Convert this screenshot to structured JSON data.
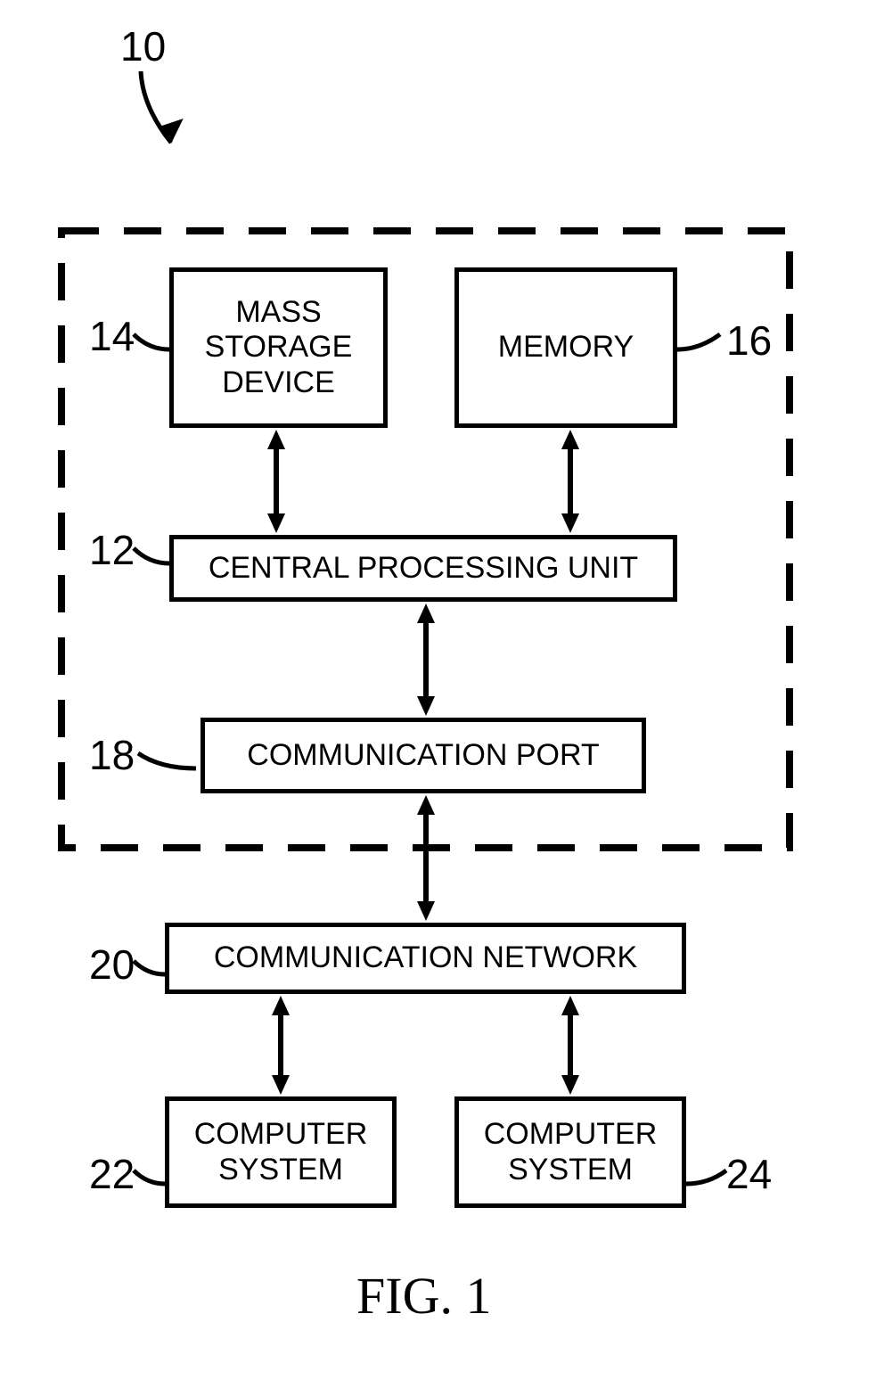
{
  "figure_label": "FIG. 1",
  "system_ref": "10",
  "blocks": {
    "mass_storage": {
      "ref": "14",
      "text": "MASS STORAGE DEVICE"
    },
    "memory": {
      "ref": "16",
      "text": "MEMORY"
    },
    "cpu": {
      "ref": "12",
      "text": "CENTRAL PROCESSING UNIT"
    },
    "comm_port": {
      "ref": "18",
      "text": "COMMUNICATION PORT"
    },
    "comm_net": {
      "ref": "20",
      "text": "COMMUNICATION NETWORK"
    },
    "comp_sys_a": {
      "ref": "22",
      "text": "COMPUTER SYSTEM"
    },
    "comp_sys_b": {
      "ref": "24",
      "text": "COMPUTER SYSTEM"
    }
  }
}
